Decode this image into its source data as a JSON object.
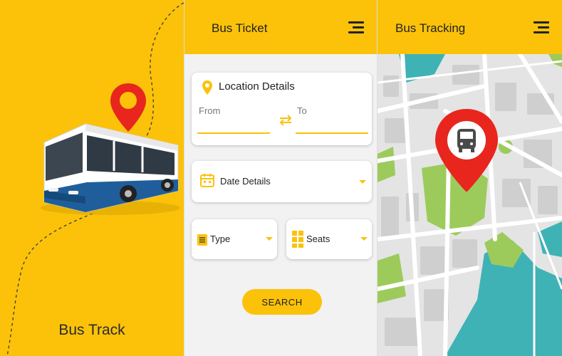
{
  "splash": {
    "brand_name": "Bus Track",
    "colors": {
      "background": "#FBC209",
      "marker": "#E8261E",
      "bus_body": "#ffffff",
      "bus_stripe": "#1F5E9B"
    },
    "icons": [
      "location-pin-icon",
      "bus-illustration"
    ]
  },
  "ticket": {
    "title": "Bus Ticket",
    "location": {
      "heading": "Location Details",
      "from_label": "From",
      "to_label": "To"
    },
    "date": {
      "label": "Date Details"
    },
    "type": {
      "label": "Type"
    },
    "seats": {
      "label": "Seats"
    },
    "search_label": "SEARCH",
    "colors": {
      "accent": "#FBC209",
      "background": "#f2f2f2",
      "card": "#ffffff"
    },
    "icons": [
      "menu-icon",
      "location-pin-icon",
      "swap-arrows-icon",
      "calendar-icon",
      "chevron-down-icon",
      "type-icon",
      "seats-grid-icon"
    ]
  },
  "tracking": {
    "title": "Bus Tracking",
    "colors": {
      "park": "#9CCB5C",
      "water": "#3FB2B6",
      "road": "#ffffff",
      "block": "#d0d0d0",
      "marker": "#E8261E"
    },
    "icons": [
      "menu-icon",
      "bus-location-marker-icon"
    ]
  }
}
